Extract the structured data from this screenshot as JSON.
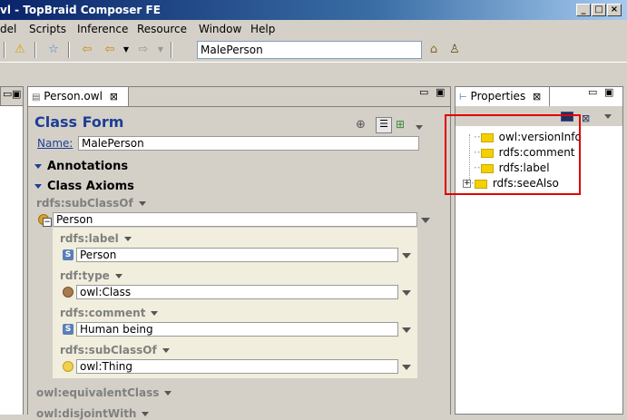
{
  "window": {
    "title": "vl - TopBraid Composer FE",
    "controls": [
      "_",
      "□",
      "×"
    ]
  },
  "menubar": [
    "del",
    "Scripts",
    "Inference",
    "Resource",
    "Window",
    "Help"
  ],
  "toolbar": {
    "search_value": "MalePerson"
  },
  "editor": {
    "tab_label": "Person.owl",
    "heading": "Class Form",
    "name_label": "Name:",
    "name_value": "MalePerson",
    "sections": {
      "annotations": "Annotations",
      "class_axioms": "Class Axioms"
    },
    "subclassof_label": "rdfs:subClassOf",
    "subclassof_value": "Person",
    "nested": {
      "label_prop": "rdfs:label",
      "label_value": "Person",
      "type_prop": "rdf:type",
      "type_value": "owl:Class",
      "comment_prop": "rdfs:comment",
      "comment_value": "Human being",
      "subclass_prop": "rdfs:subClassOf",
      "subclass_value": "owl:Thing"
    },
    "equivalent_label": "owl:equivalentClass",
    "disjoint_label": "owl:disjointWith"
  },
  "properties": {
    "tab_label": "Properties",
    "items": [
      "owl:versionInfo",
      "rdfs:comment",
      "rdfs:label",
      "rdfs:seeAlso"
    ]
  },
  "colors": {
    "heading": "#1c3f94",
    "highlight_box": "#e00000",
    "folder": "#f5d000"
  }
}
